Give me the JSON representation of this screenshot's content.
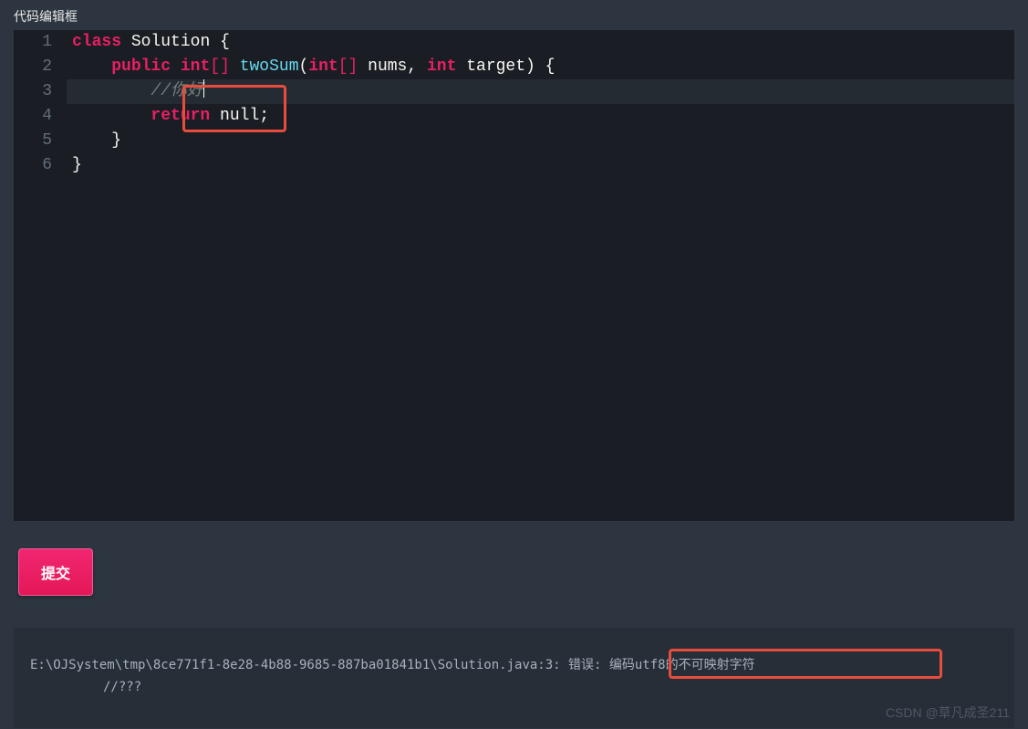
{
  "panel_title": "代码编辑框",
  "editor": {
    "lines": [
      {
        "num": "1",
        "active": false
      },
      {
        "num": "2",
        "active": false
      },
      {
        "num": "3",
        "active": true
      },
      {
        "num": "4",
        "active": false
      },
      {
        "num": "5",
        "active": false
      },
      {
        "num": "6",
        "active": false
      }
    ],
    "code": {
      "l1_class": "class",
      "l1_name": "Solution",
      "l1_brace": "{",
      "l2_public": "public",
      "l2_int": "int",
      "l2_br1": "[",
      "l2_br2": "]",
      "l2_method": "twoSum",
      "l2_paren1": "(",
      "l2_int2": "int",
      "l2_br3": "[",
      "l2_br4": "]",
      "l2_nums": "nums",
      "l2_comma": ",",
      "l2_int3": "int",
      "l2_target": "target",
      "l2_paren2": ")",
      "l2_brace": "{",
      "l3_comment": "//你好",
      "l4_return": "return",
      "l4_null": "null",
      "l4_semi": ";",
      "l5_brace": "}",
      "l6_brace": "}"
    }
  },
  "submit_label": "提交",
  "output": {
    "line1_path": "E:\\OJSystem\\tmp\\8ce771f1-8e28-4b88-9685-887ba01841b1\\Solution.java:3:",
    "line1_error": " 错误: 编码utf8的不可映射字符",
    "line2": "//???"
  },
  "watermark": "CSDN @草凡成圣211"
}
